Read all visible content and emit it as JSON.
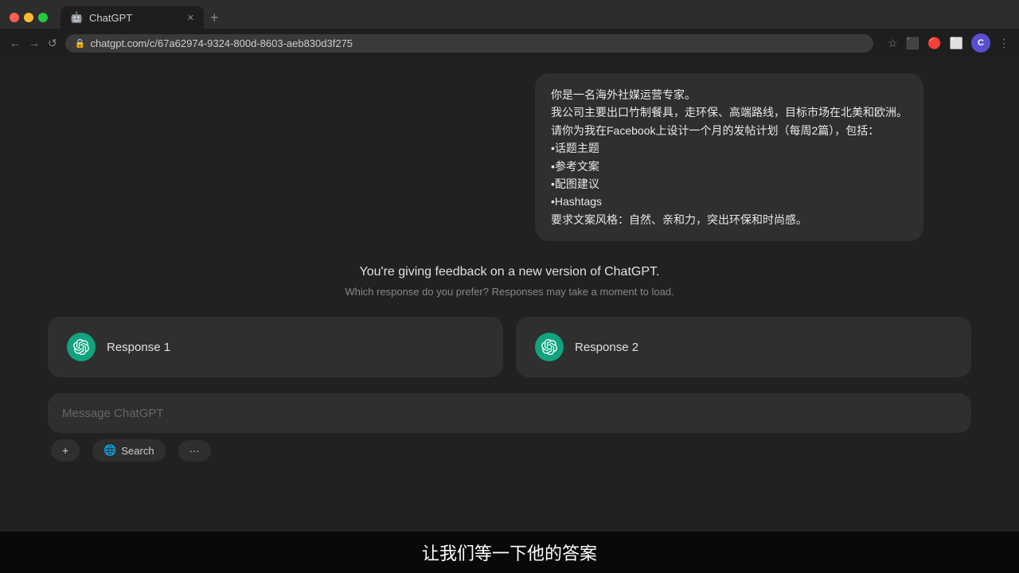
{
  "browser": {
    "tab_title": "ChatGPT",
    "tab_favicon": "🤖",
    "url": "chatgpt.com/c/67a62974-9324-800d-8603-aeb830d3f275",
    "nav_back": "←",
    "nav_forward": "→",
    "nav_reload": "↺",
    "toolbar": {
      "bookmark": "☆",
      "extension1": "🧩",
      "extension2": "🔲",
      "extension3": "🧩",
      "avatar_label": "C",
      "more": "⋮"
    }
  },
  "chat": {
    "user_message_lines": [
      "你是一名海外社媒运营专家。",
      "我公司主要出口竹制餐具，走环保、高端路线，目标市场在北美和欧洲。",
      "请你为我在Facebook上设计一个月的发帖计划（每周2篇），包括：",
      "•话题主题",
      "•参考文案",
      "•配图建议",
      "•Hashtags",
      "要求文案风格：自然、亲和力，突出环保和时尚感。"
    ]
  },
  "feedback": {
    "title": "You're giving feedback on a new version of ChatGPT.",
    "subtitle": "Which response do you prefer? Responses may take a moment to load."
  },
  "responses": [
    {
      "label": "Response 1"
    },
    {
      "label": "Response 2"
    }
  ],
  "input": {
    "placeholder": "Message ChatGPT",
    "btn_add": "+",
    "btn_search": "Search",
    "btn_more": "···"
  },
  "subtitle": {
    "text": "让我们等一下他的答案"
  }
}
